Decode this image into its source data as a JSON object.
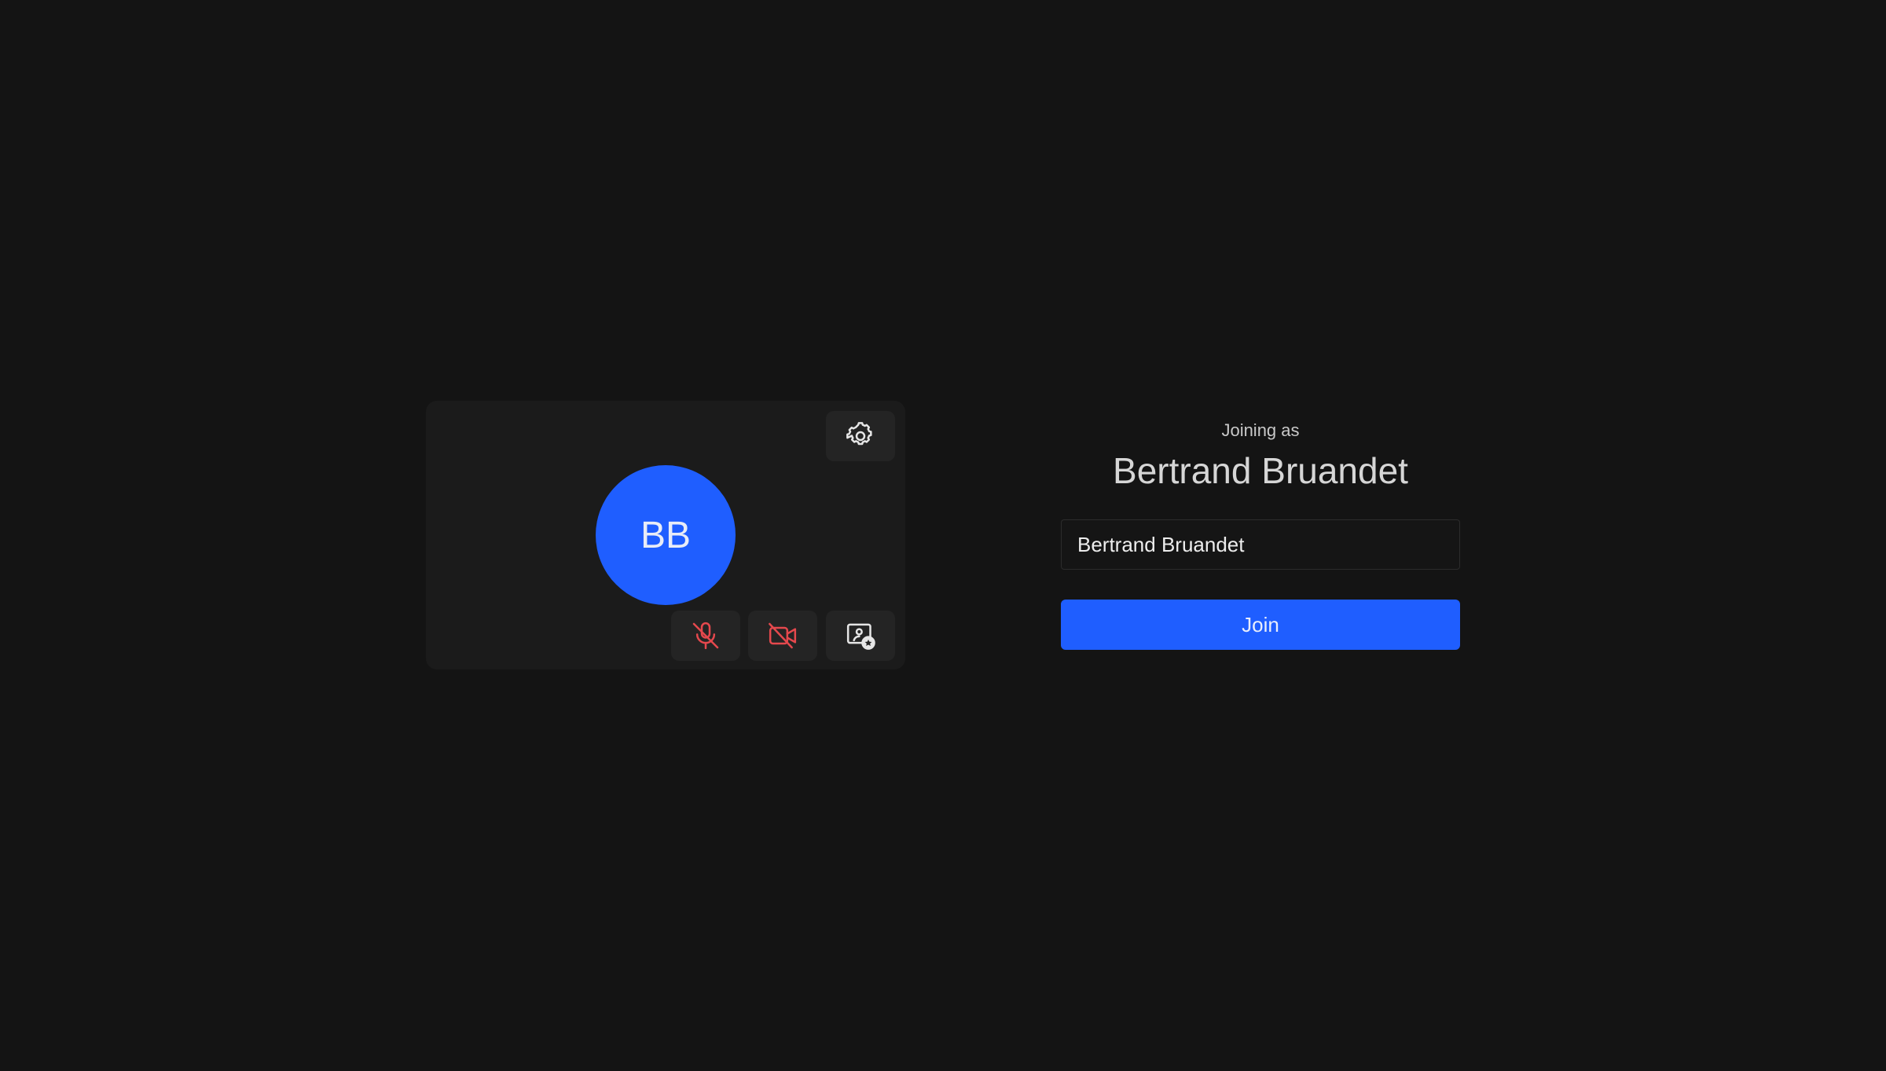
{
  "preview": {
    "avatar_initials": "BB",
    "avatar_color": "#1f5eff",
    "icons": {
      "settings": "gear-icon",
      "microphone": "microphone-off-icon",
      "camera": "camera-off-icon",
      "background": "background-effects-icon"
    },
    "muted_color": "#e5484d"
  },
  "join": {
    "joining_label": "Joining as",
    "display_name": "Bertrand Bruandet",
    "name_input_value": "Bertrand Bruandet",
    "join_label": "Join",
    "accent_color": "#1f5eff"
  }
}
